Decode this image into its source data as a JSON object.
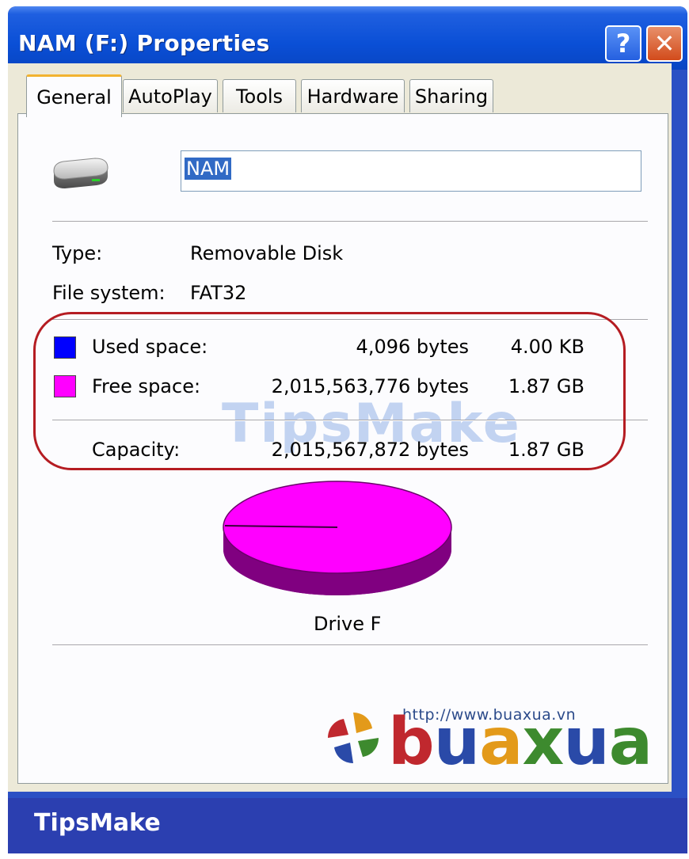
{
  "window": {
    "title": "NAM (F:) Properties",
    "help_label": "?",
    "close_label": "✕"
  },
  "tabs": [
    {
      "label": "General",
      "active": true
    },
    {
      "label": "AutoPlay",
      "active": false
    },
    {
      "label": "Tools",
      "active": false
    },
    {
      "label": "Hardware",
      "active": false
    },
    {
      "label": "Sharing",
      "active": false
    }
  ],
  "general": {
    "drive_icon": "drive-icon",
    "name_value": "NAM",
    "type_label": "Type:",
    "type_value": "Removable Disk",
    "fs_label": "File system:",
    "fs_value": "FAT32",
    "used": {
      "label": "Used space:",
      "bytes": "4,096 bytes",
      "size": "4.00 KB",
      "color": "#0000ff"
    },
    "free": {
      "label": "Free space:",
      "bytes": "2,015,563,776 bytes",
      "size": "1.87 GB",
      "color": "#ff00ff"
    },
    "capacity": {
      "label": "Capacity:",
      "bytes": "2,015,567,872 bytes",
      "size": "1.87 GB"
    },
    "drive_label": "Drive F",
    "used_fraction": 2e-06
  },
  "watermark": "TipsMake",
  "branding": {
    "url": "http://www.buaxua.vn",
    "letters": [
      {
        "ch": "b",
        "color": "#c0282e"
      },
      {
        "ch": "u",
        "color": "#2a4aa8"
      },
      {
        "ch": "a",
        "color": "#e39a1a"
      },
      {
        "ch": "x",
        "color": "#3d8a2e"
      },
      {
        "ch": "u",
        "color": "#2a4aa8"
      },
      {
        "ch": "a",
        "color": "#3d8a2e"
      }
    ],
    "footer_brand": "TipsMake"
  },
  "colors": {
    "accent": "#0a4fd6",
    "used": "#0000ff",
    "free": "#ff00ff",
    "ring": "#b51c22"
  }
}
